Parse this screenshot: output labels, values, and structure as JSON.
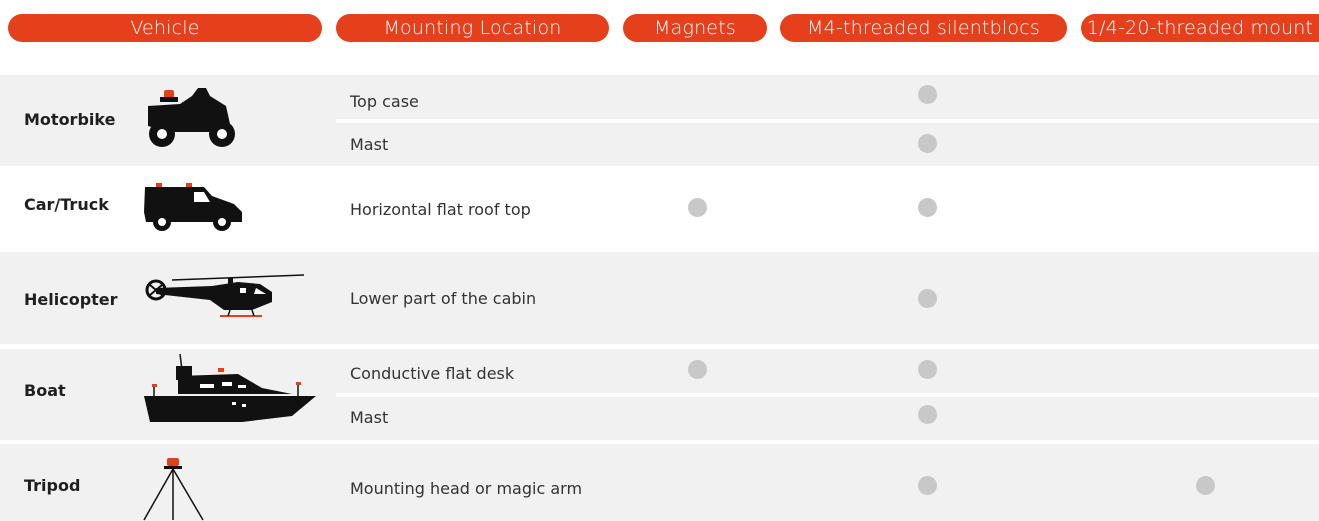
{
  "header": {
    "vehicle": "Vehicle",
    "mounting_location": "Mounting Location",
    "magnets": "Magnets",
    "m4": "M4-threaded silentblocs",
    "quarter": "1/4-20-threaded mount"
  },
  "rows": {
    "motorbike": {
      "name": "Motorbike",
      "icon": "motorbike-icon",
      "locations": [
        {
          "label": "Top case",
          "magnets": false,
          "m4": true,
          "quarter": false
        },
        {
          "label": "Mast",
          "magnets": false,
          "m4": true,
          "quarter": false
        }
      ]
    },
    "car": {
      "name": "Car/Truck",
      "icon": "van-icon",
      "locations": [
        {
          "label": "Horizontal flat roof top",
          "magnets": true,
          "m4": true,
          "quarter": false
        }
      ]
    },
    "helicopter": {
      "name": "Helicopter",
      "icon": "helicopter-icon",
      "locations": [
        {
          "label": "Lower part of the cabin",
          "magnets": false,
          "m4": true,
          "quarter": false
        }
      ]
    },
    "boat": {
      "name": "Boat",
      "icon": "boat-icon",
      "locations": [
        {
          "label": "Conductive flat desk",
          "magnets": true,
          "m4": true,
          "quarter": false
        },
        {
          "label": "Mast",
          "magnets": false,
          "m4": true,
          "quarter": false
        }
      ]
    },
    "tripod": {
      "name": "Tripod",
      "icon": "tripod-icon",
      "locations": [
        {
          "label": "Mounting head or magic arm",
          "magnets": false,
          "m4": true,
          "quarter": true
        }
      ]
    }
  },
  "colors": {
    "accent": "#e63f1c",
    "band": "#f1f1f1",
    "dot": "#c8c8c8",
    "silhouette": "#111111"
  }
}
